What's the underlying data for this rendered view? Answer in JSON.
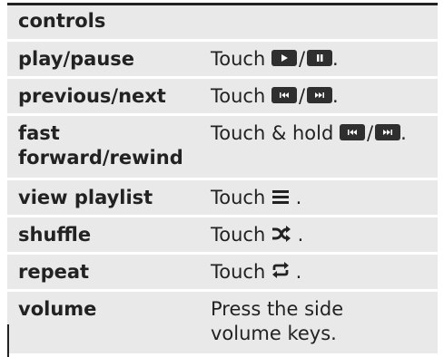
{
  "header": {
    "title": "controls"
  },
  "rows": [
    {
      "label": "play/pause",
      "prefix": "Touch ",
      "sep": "/",
      "suffix": "."
    },
    {
      "label": "previous/next",
      "prefix": "Touch ",
      "sep": "/",
      "suffix": "."
    },
    {
      "label_line1": "fast",
      "label_line2": "forward/rewind",
      "prefix": "Touch & hold ",
      "sep": "/",
      "suffix": "."
    },
    {
      "label": "view playlist",
      "prefix": "Touch ",
      "suffix": " ."
    },
    {
      "label": "shuffle",
      "prefix": "Touch ",
      "suffix": " ."
    },
    {
      "label": "repeat",
      "prefix": "Touch ",
      "suffix": " ."
    },
    {
      "label": "volume",
      "desc_line1": "Press the side",
      "desc_line2": "volume keys."
    }
  ],
  "icons": {
    "play": "play-icon",
    "pause": "pause-icon",
    "previous": "previous-icon",
    "next": "next-icon",
    "playlist": "playlist-icon",
    "shuffle": "shuffle-icon",
    "repeat": "repeat-icon"
  },
  "colors": {
    "row_bg": "#e9e9e9",
    "text": "#222222",
    "button_bg": "#2f2f2f"
  }
}
